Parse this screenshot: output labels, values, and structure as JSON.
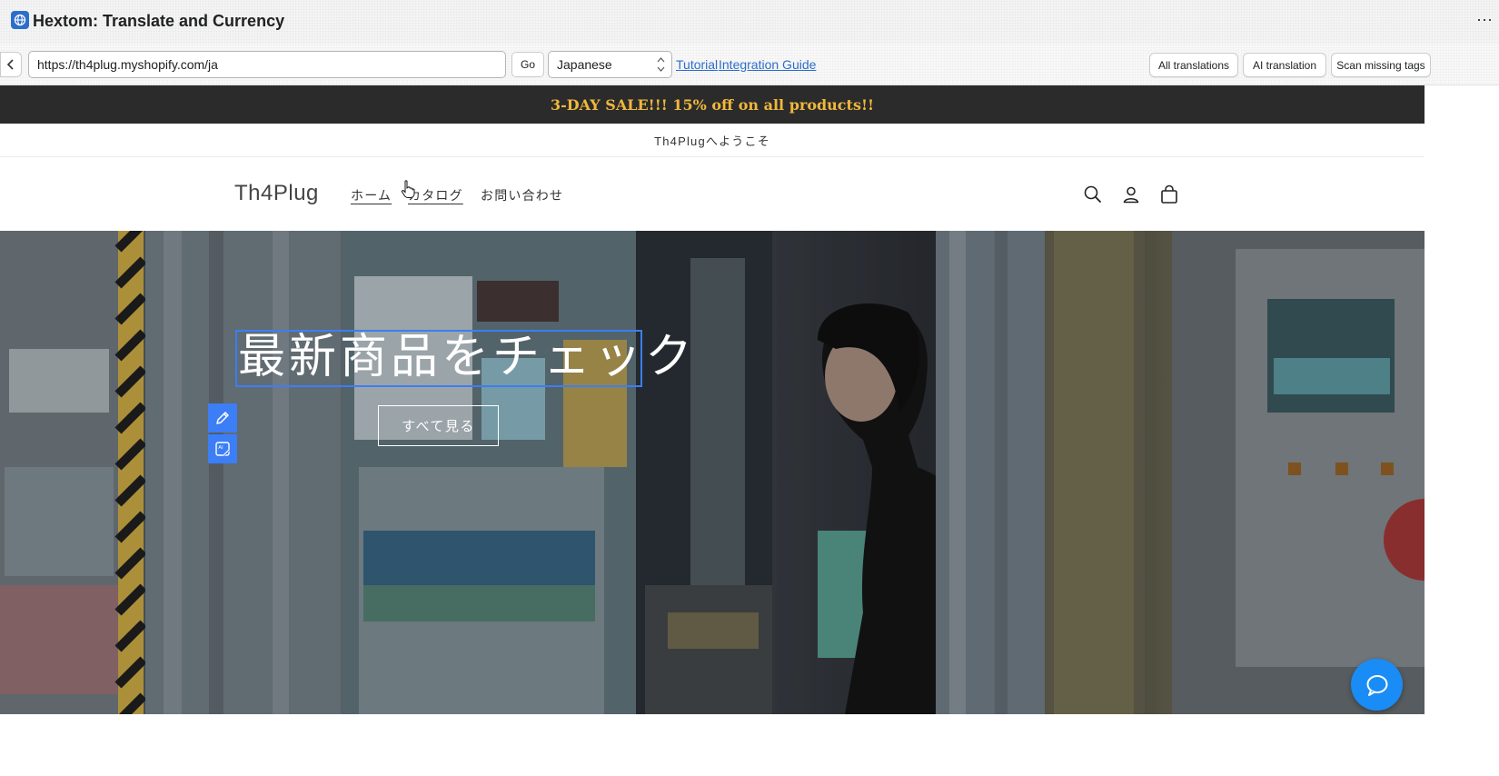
{
  "window": {
    "title": "Hextom: Translate and Currency",
    "more_label": "⋯"
  },
  "toolbar": {
    "url": "https://th4plug.myshopify.com/ja",
    "go_label": "Go",
    "language": "Japanese",
    "tutorial_label": "Tutorial",
    "integration_label": "Integration Guide",
    "all_translations_label": "All translations",
    "ai_translation_label": "AI translation",
    "scan_missing_label": "Scan missing tags"
  },
  "store": {
    "announcement": "3-DAY SALE!!! 15% off on all products!!",
    "welcome": "Th4Plugへようこそ",
    "logo": "Th4Plug",
    "nav": [
      {
        "label": "ホーム"
      },
      {
        "label": "カタログ"
      },
      {
        "label": "お問い合わせ"
      }
    ],
    "hero": {
      "heading": "最新商品をチェック",
      "button_label": "すべて見る"
    }
  },
  "colors": {
    "accent": "#3b7ef6",
    "announcement_bg": "#2b2b2b",
    "announcement_text": "#f0b73c",
    "link": "#2c6ecb",
    "chat": "#1a8cf5"
  },
  "icons": {
    "app": "globe-icon",
    "back": "chevron-left-icon",
    "search": "search-icon",
    "account": "account-icon",
    "cart": "cart-icon",
    "edit": "pencil-icon",
    "ai": "ai-translate-icon",
    "chat": "chat-icon",
    "cursor": "hand-cursor-icon"
  }
}
